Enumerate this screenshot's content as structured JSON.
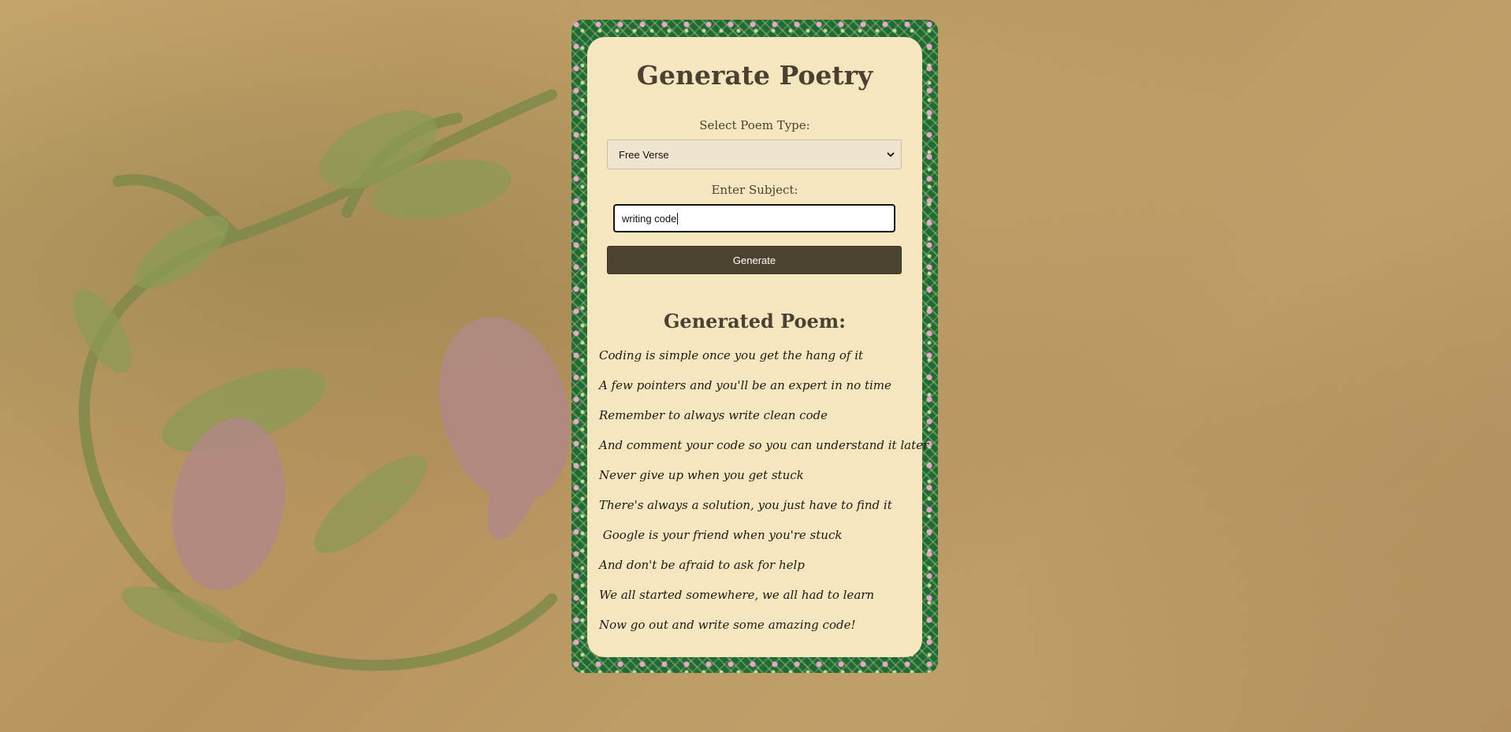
{
  "form": {
    "title": "Generate Poetry",
    "poem_type_label": "Select Poem Type:",
    "poem_type_value": "Free Verse",
    "subject_label": "Enter Subject:",
    "subject_value": "writing code",
    "generate_label": "Generate"
  },
  "result": {
    "title": "Generated Poem:",
    "lines": [
      "Coding is simple once you get the hang of it",
      "A few pointers and you'll be an expert in no time",
      "Remember to always write clean code",
      "And comment your code so you can understand it later",
      "Never give up when you get stuck",
      "There's always a solution, you just have to find it",
      " Google is your friend when you're stuck",
      "And don't be afraid to ask for help",
      "We all started somewhere, we all had to learn",
      "Now go out and write some amazing code!"
    ]
  },
  "colors": {
    "card_background": "#f5e6bf",
    "frame_green": "#1f6b34",
    "button_background": "#4b4330",
    "heading_text": "#4a4130"
  },
  "icons": {
    "select_arrow": "chevron-down-icon"
  }
}
